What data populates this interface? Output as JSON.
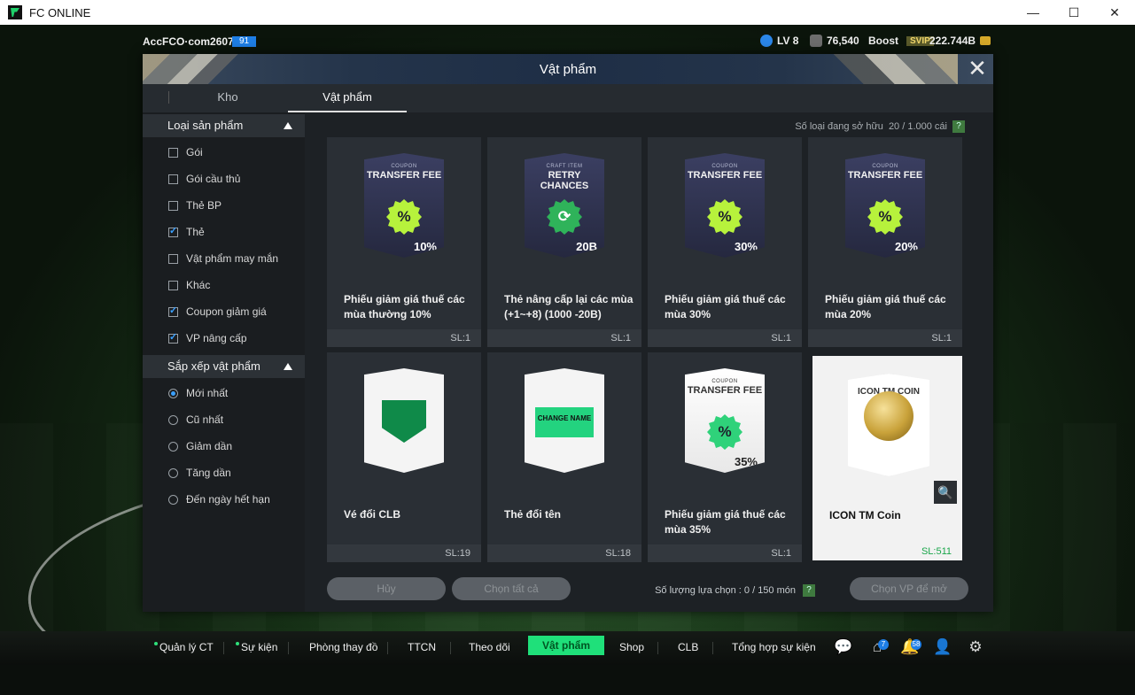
{
  "window": {
    "title": "FC ONLINE",
    "controls": [
      "—",
      "☐",
      "✕"
    ]
  },
  "status": {
    "account": "AccFCO·com2607a",
    "account_badge": "91",
    "level": "LV 8",
    "points": "76,540",
    "boost_label": "Boost",
    "svip": "SVIP",
    "balance": "222.744B"
  },
  "panel": {
    "title": "Vật phẩm",
    "tabs": [
      {
        "label": "Kho",
        "active": false
      },
      {
        "label": "Vật phẩm",
        "active": true
      }
    ]
  },
  "sidebar": {
    "filter_header": "Loại sản phẩm",
    "filters": [
      {
        "label": "Gói",
        "checked": false
      },
      {
        "label": "Gói cầu thủ",
        "checked": false
      },
      {
        "label": "Thẻ BP",
        "checked": false
      },
      {
        "label": "Thẻ",
        "checked": true
      },
      {
        "label": "Vật phẩm may mắn",
        "checked": false
      },
      {
        "label": "Khác",
        "checked": false
      },
      {
        "label": "Coupon giảm giá",
        "checked": true
      },
      {
        "label": "VP nâng cấp",
        "checked": true
      }
    ],
    "sort_header": "Sắp xếp vật phẩm",
    "sorts": [
      {
        "label": "Mới nhất",
        "selected": true
      },
      {
        "label": "Cũ nhất",
        "selected": false
      },
      {
        "label": "Giảm dần",
        "selected": false
      },
      {
        "label": "Tăng dần",
        "selected": false
      },
      {
        "label": "Đến ngày hết hạn",
        "selected": false
      }
    ]
  },
  "owned": {
    "label": "Số loại đang sở hữu",
    "value": "20 / 1.000 cái",
    "help": "?"
  },
  "items": [
    {
      "name": "Phiếu giảm giá thuế các mùa thường 10%",
      "qty": "SL:1",
      "graphic": "coupon",
      "tag": "COUPON",
      "title": "TRANSFER FEE",
      "value": "10%",
      "badge": "%"
    },
    {
      "name": "Thẻ nâng cấp lại các mùa (+1~+8) (1000 -20B)",
      "qty": "SL:1",
      "graphic": "coupon",
      "tag": "CRAFT ITEM",
      "title": "RETRY CHANCES",
      "value": "20B",
      "badge": "⟳"
    },
    {
      "name": "Phiếu giảm giá thuế các mùa 30%",
      "qty": "SL:1",
      "graphic": "coupon",
      "tag": "COUPON",
      "title": "TRANSFER FEE",
      "value": "30%",
      "badge": "%"
    },
    {
      "name": "Phiếu giảm giá thuế các mùa 20%",
      "qty": "SL:1",
      "graphic": "coupon",
      "tag": "COUPON",
      "title": "TRANSFER FEE",
      "value": "20%",
      "badge": "%"
    },
    {
      "name": "Vé đổi CLB",
      "qty": "SL:19",
      "graphic": "shield",
      "emblem": ""
    },
    {
      "name": "Thẻ đổi tên",
      "qty": "SL:18",
      "graphic": "shield",
      "emblem": "CHANGE NAME"
    },
    {
      "name": "Phiếu giảm giá thuế các mùa 35%",
      "qty": "SL:1",
      "graphic": "coupon-white",
      "tag": "COUPON",
      "title": "TRANSFER FEE",
      "value": "35%",
      "badge": "%"
    },
    {
      "name": "ICON TM Coin",
      "qty": "SL:511",
      "graphic": "coin",
      "coin_label": "ICON TM COIN",
      "selected": true
    }
  ],
  "actions": {
    "cancel": "Hủy",
    "select_all": "Chọn tất cả",
    "count_label": "Số lượng lựa chọn : 0 / 150 món",
    "help": "?",
    "open": "Chọn VP để mở"
  },
  "nav": {
    "items": [
      "Quản lý CT",
      "Sự kiện",
      "Phòng thay đồ",
      "TTCN",
      "Theo dõi",
      "Vật phẩm",
      "Shop",
      "CLB",
      "Tổng hợp sự kiện"
    ],
    "active": "Vật phẩm",
    "home_badge": "7",
    "bell_badge": "58"
  },
  "colors": {
    "accent": "#1fe07a",
    "checkbox": "#3aa0ff",
    "badge": "#1e7ee6"
  }
}
